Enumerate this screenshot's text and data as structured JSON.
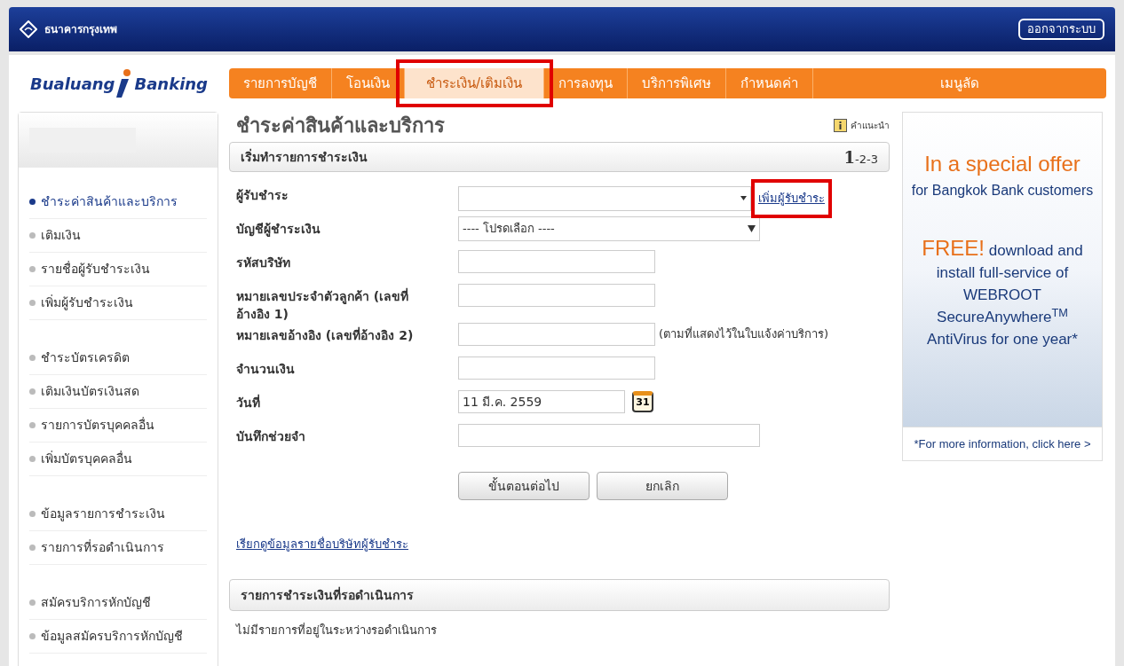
{
  "header": {
    "bank_name": "ธนาคารกรุงเทพ",
    "logout": "ออกจากระบบ"
  },
  "brand": {
    "left": "Bualuang",
    "right": "Banking"
  },
  "nav": [
    {
      "label": "รายการบัญชี",
      "selected": false,
      "annotated": false
    },
    {
      "label": "โอนเงิน",
      "selected": false,
      "annotated": false
    },
    {
      "label": "ชำระเงิน/เติมเงิน",
      "selected": true,
      "annotated": true
    },
    {
      "label": "การลงทุน",
      "selected": false,
      "annotated": false
    },
    {
      "label": "บริการพิเศษ",
      "selected": false,
      "annotated": false
    },
    {
      "label": "กำหนดค่า",
      "selected": false,
      "annotated": false
    },
    {
      "label": "เมนูลัด",
      "selected": false,
      "annotated": false
    }
  ],
  "sidebar": {
    "groups": [
      [
        {
          "label": "ชำระค่าสินค้าและบริการ",
          "selected": true
        },
        {
          "label": "เติมเงิน",
          "selected": false
        },
        {
          "label": "รายชื่อผู้รับชำระเงิน",
          "selected": false
        },
        {
          "label": "เพิ่มผู้รับชำระเงิน",
          "selected": false
        }
      ],
      [
        {
          "label": "ชำระบัตรเครดิต",
          "selected": false
        },
        {
          "label": "เติมเงินบัตรเงินสด",
          "selected": false
        },
        {
          "label": "รายการบัตรบุคคลอื่น",
          "selected": false
        },
        {
          "label": "เพิ่มบัตรบุคคลอื่น",
          "selected": false
        }
      ],
      [
        {
          "label": "ข้อมูลรายการชำระเงิน",
          "selected": false
        },
        {
          "label": "รายการที่รอดำเนินการ",
          "selected": false
        }
      ],
      [
        {
          "label": "สมัครบริการหักบัญชี",
          "selected": false
        },
        {
          "label": "ข้อมูลสมัครบริการหักบัญชี",
          "selected": false
        }
      ]
    ]
  },
  "page": {
    "title": "ชำระค่าสินค้าและบริการ",
    "help": "คำแนะนำ",
    "section": {
      "title": "เริ่มทำรายการชำระเงิน",
      "steps": [
        {
          "label": "1",
          "selected": true
        },
        {
          "label": "-2",
          "selected": false
        },
        {
          "label": "-3",
          "selected": false
        }
      ]
    },
    "fields": [
      {
        "kind": "combo",
        "label": "ผู้รับชำระ",
        "link": {
          "label": "เพิ่มผู้รับชำระ",
          "annotated": true
        }
      },
      {
        "kind": "select",
        "label": "บัญชีผู้ชำระเงิน",
        "value": "---- โปรดเลือก ----"
      },
      {
        "kind": "text",
        "label": "รหัสบริษัท"
      },
      {
        "kind": "text",
        "label": "หมายเลขประจำตัวลูกค้า (เลขที่อ้างอิง 1)"
      },
      {
        "kind": "text",
        "label": "หมายเลขอ้างอิง (เลขที่อ้างอิง 2)",
        "note": "(ตามที่แสดงไว้ในใบแจ้งค่าบริการ)"
      },
      {
        "kind": "text",
        "label": "จำนวนเงิน"
      },
      {
        "kind": "date",
        "label": "วันที่",
        "value": "11 มี.ค. 2559",
        "calendar_day": "31"
      },
      {
        "kind": "wide",
        "label": "บันทึกช่วยจำ"
      }
    ],
    "buttons": [
      "ขั้นตอนต่อไป",
      "ยกเลิก"
    ],
    "lookup_link": "เรียกดูข้อมูลรายชื่อบริษัทผู้รับชำระ",
    "pending": {
      "title": "รายการชำระเงินที่รอดำเนินการ",
      "empty": "ไม่มีรายการที่อยู่ในระหว่างรอดำเนินการ"
    }
  },
  "ad": {
    "headline": "In a special offer",
    "sub": "for Bangkok Bank customers",
    "free": "FREE!",
    "body": "download and install full-service of WEBROOT SecureAnywhere$^{TM}$ AntiVirus for one year*",
    "footer": "*For more information, click here >"
  }
}
